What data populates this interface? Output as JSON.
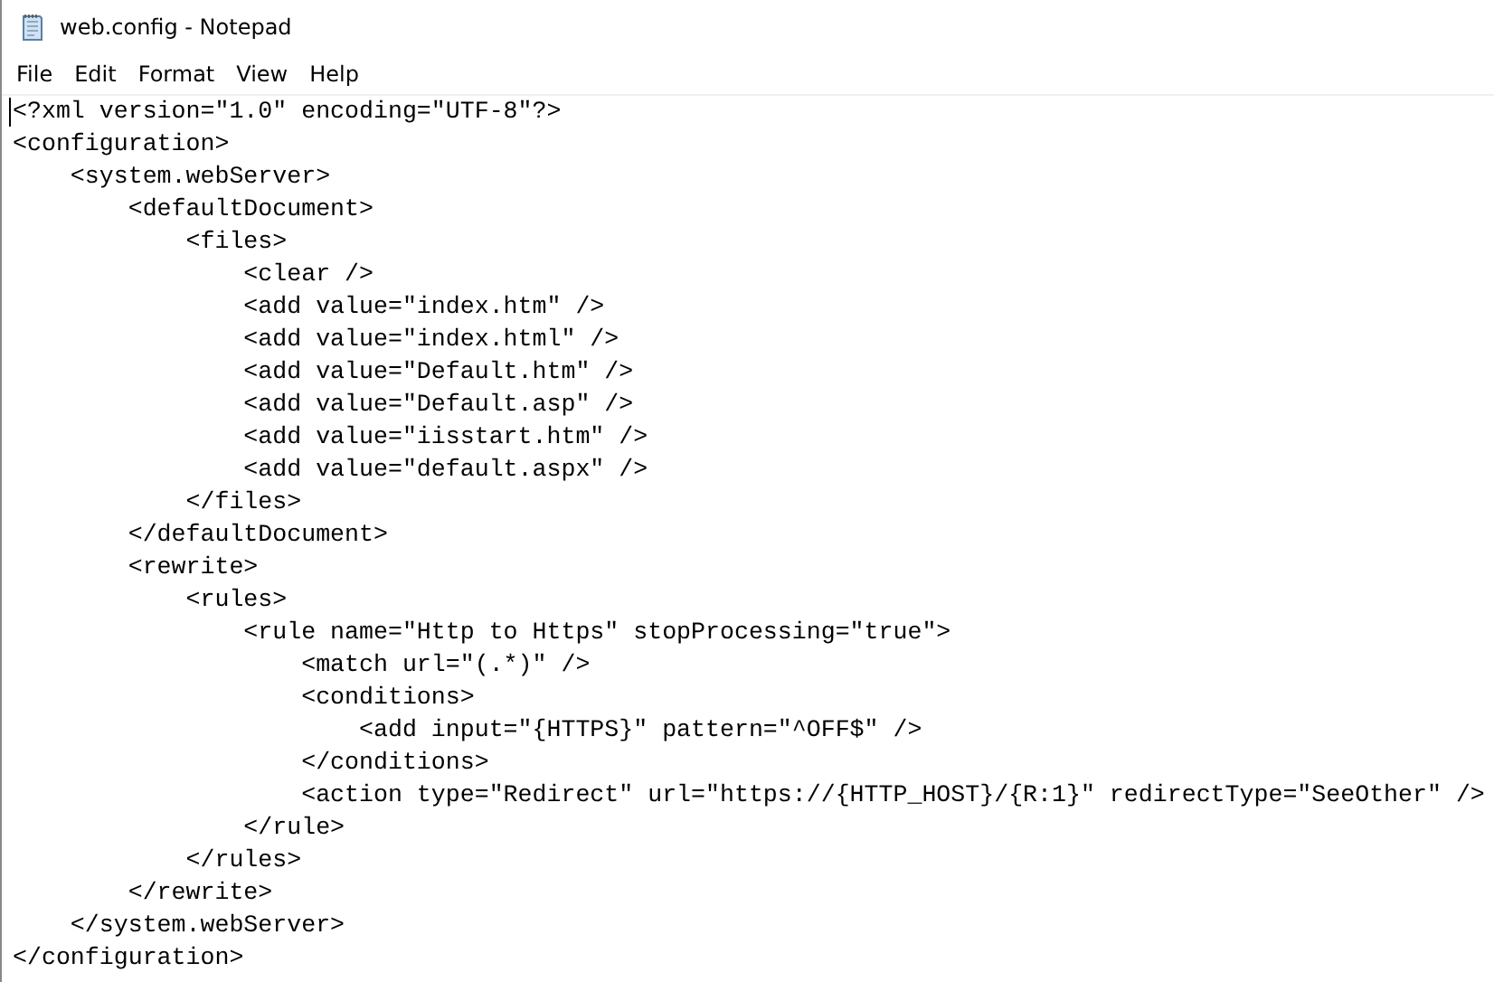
{
  "window": {
    "title": "web.config - Notepad"
  },
  "menu": [
    "File",
    "Edit",
    "Format",
    "View",
    "Help"
  ],
  "editor": {
    "lines": [
      "<?xml version=\"1.0\" encoding=\"UTF-8\"?>",
      "<configuration>",
      "    <system.webServer>",
      "        <defaultDocument>",
      "            <files>",
      "                <clear />",
      "                <add value=\"index.htm\" />",
      "                <add value=\"index.html\" />",
      "                <add value=\"Default.htm\" />",
      "                <add value=\"Default.asp\" />",
      "                <add value=\"iisstart.htm\" />",
      "                <add value=\"default.aspx\" />",
      "            </files>",
      "        </defaultDocument>",
      "        <rewrite>",
      "            <rules>",
      "                <rule name=\"Http to Https\" stopProcessing=\"true\">",
      "                    <match url=\"(.*)\" />",
      "                    <conditions>",
      "                        <add input=\"{HTTPS}\" pattern=\"^OFF$\" />",
      "                    </conditions>",
      "                    <action type=\"Redirect\" url=\"https://{HTTP_HOST}/{R:1}\" redirectType=\"SeeOther\" />",
      "                </rule>",
      "            </rules>",
      "        </rewrite>",
      "    </system.webServer>",
      "</configuration>"
    ]
  }
}
